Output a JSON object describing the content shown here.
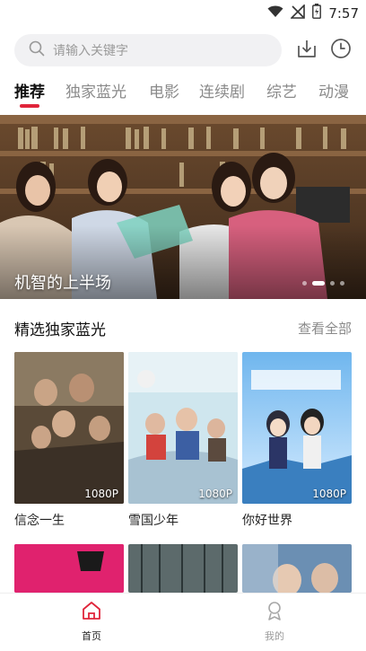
{
  "status_bar": {
    "time": "7:57",
    "icons": [
      "wifi-icon",
      "signal-off-icon",
      "battery-icon"
    ]
  },
  "search": {
    "placeholder": "请输入关键字",
    "icons": [
      "search-icon",
      "download-icon",
      "history-icon"
    ]
  },
  "tabs": [
    {
      "label": "推荐",
      "active": true
    },
    {
      "label": "独家蓝光",
      "active": false
    },
    {
      "label": "电影",
      "active": false
    },
    {
      "label": "连续剧",
      "active": false
    },
    {
      "label": "综艺",
      "active": false
    },
    {
      "label": "动漫",
      "active": false
    }
  ],
  "banner": {
    "title": "机智的上半场",
    "slide_count": 4,
    "active_index": 1
  },
  "section": {
    "title": "精选独家蓝光",
    "see_all": "查看全部",
    "items": [
      {
        "title": "信念一生",
        "badge": "1080P"
      },
      {
        "title": "雪国少年",
        "badge": "1080P"
      },
      {
        "title": "你好世界",
        "badge": "1080P"
      }
    ]
  },
  "bottom_nav": [
    {
      "label": "首页",
      "icon": "home-icon",
      "active": true
    },
    {
      "label": "我的",
      "icon": "profile-icon",
      "active": false
    }
  ],
  "colors": {
    "accent": "#e0243a",
    "inactive": "#8a8a8a",
    "search_bg": "#f1f1f3"
  }
}
